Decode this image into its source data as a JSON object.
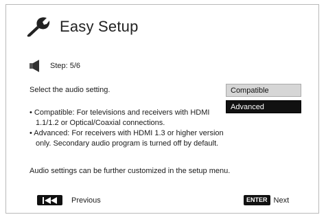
{
  "header": {
    "icon": "wrench-icon",
    "title": "Easy Setup"
  },
  "step": {
    "icon": "speaker-icon",
    "label": "Step: 5/6"
  },
  "prompt": "Select the audio setting.",
  "description": {
    "compatible": "• Compatible: For televisions and receivers with HDMI 1.1/1.2 or Optical/Coaxial connections.",
    "advanced": "• Advanced: For receivers with HDMI 1.3 or higher version only. Secondary audio program is turned off by default.",
    "note": "Audio settings can be further customized in the setup menu."
  },
  "options": [
    {
      "label": "Compatible",
      "selected": false
    },
    {
      "label": "Advanced",
      "selected": true
    }
  ],
  "navigation": {
    "previous": {
      "key_icon": "skip-back-icon",
      "label": "Previous"
    },
    "next": {
      "key_label": "ENTER",
      "label": "Next"
    }
  },
  "colors": {
    "selected_bg": "#111111",
    "option_bg": "#d6d6d6",
    "border": "#b9b9b9"
  }
}
